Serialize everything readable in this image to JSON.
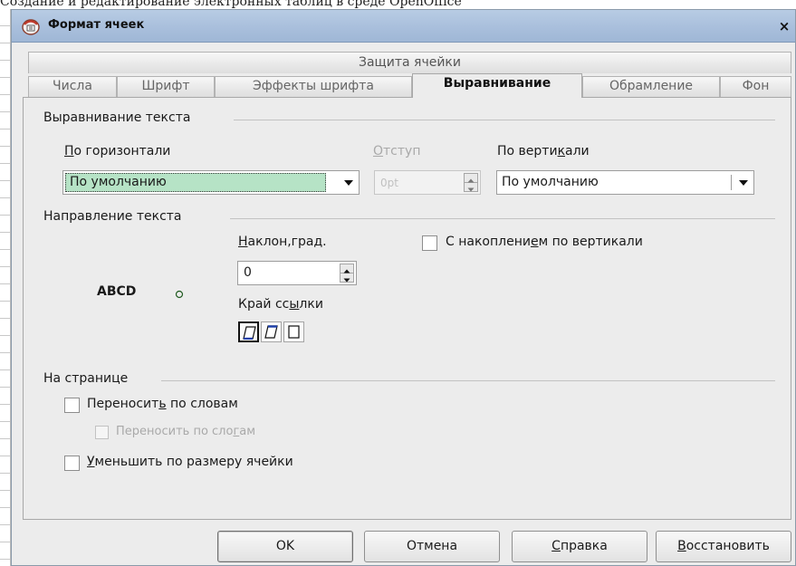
{
  "background": {
    "top_text": "Создание и редактирование электронных таблиц в среде OpenOffice"
  },
  "dialog": {
    "title": "Формат ячеек",
    "close_label": "×"
  },
  "tabs": {
    "row1": [
      "Защита ячейки"
    ],
    "row2": [
      "Числа",
      "Шрифт",
      "Эффекты шрифта",
      "Выравнивание",
      "Обрамление",
      "Фон"
    ],
    "active": "Выравнивание"
  },
  "text_alignment": {
    "section": "Выравнивание текста",
    "horizontal_label_u": "П",
    "horizontal_label_rest": "о горизонтали",
    "horizontal_value": "По умолчанию",
    "indent_label_u": "О",
    "indent_label_rest": "тступ",
    "indent_value": "0pt",
    "vertical_label_pre": "По верти",
    "vertical_label_u": "к",
    "vertical_label_post": "али",
    "vertical_value": "По умолчанию"
  },
  "text_direction": {
    "section": "Направление текста",
    "preview_text": "ABCD",
    "angle_label_u": "Н",
    "angle_label_rest": "аклон,град.",
    "angle_value": "0",
    "ref_edge_label_pre": "Край сс",
    "ref_edge_label_u": "ы",
    "ref_edge_label_post": "лки",
    "stacked_label_pre": "С накоплени",
    "stacked_label_u": "е",
    "stacked_label_mid": "м",
    "stacked_label_post": " по вертикали"
  },
  "on_page": {
    "section": "На странице",
    "wrap_pre": "Переносит",
    "wrap_u": "ь",
    "wrap_post": " по словам",
    "hyph_pre": "Переносить по сло",
    "hyph_u": "г",
    "hyph_post": "ам",
    "shrink_u": "У",
    "shrink_rest": "меньшить по размеру ячейки"
  },
  "buttons": {
    "ok": "OK",
    "cancel": "Отмена",
    "help_u": "С",
    "help_rest": "правка",
    "reset_u": "В",
    "reset_rest": "осстановить"
  },
  "colors": {
    "titlebar": "#a9bfdc",
    "selection": "#b6e3c6",
    "dialog_bg": "#ececec"
  },
  "icons": [
    "app-icon",
    "close-icon",
    "dropdown-arrow-icon",
    "spin-up-icon",
    "spin-down-icon",
    "angle-dial-icon",
    "ref-edge-bottom-icon",
    "ref-edge-top-icon",
    "ref-edge-cell-icon"
  ]
}
